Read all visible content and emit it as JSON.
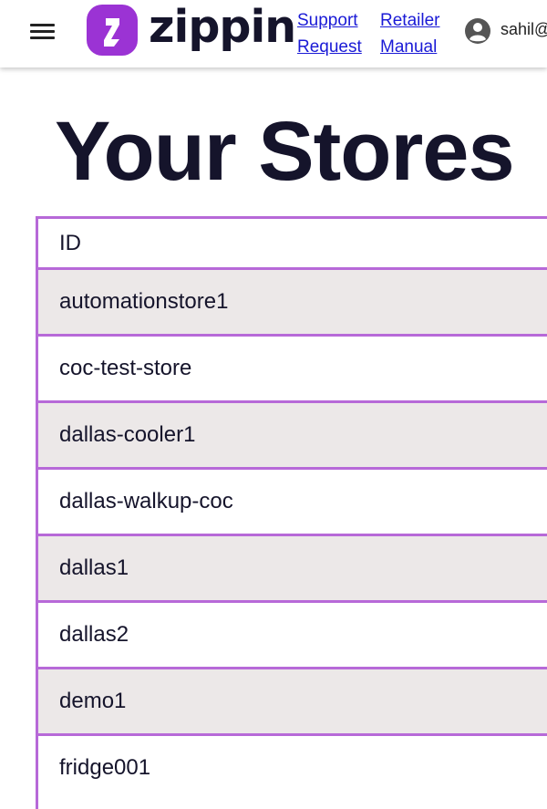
{
  "header": {
    "brand_name": "zippin",
    "nav_links": [
      {
        "lines": [
          "Support",
          "Request"
        ]
      },
      {
        "lines": [
          "Retailer",
          "Manual"
        ]
      }
    ],
    "username": "sahil@",
    "accent_color": "#9b33d4"
  },
  "page": {
    "title": "Your Stores"
  },
  "stores_table": {
    "columns": [
      "ID"
    ],
    "border_color": "#b769d8",
    "shaded_row_color": "#ece8e8",
    "rows": [
      "automationstore1",
      "coc-test-store",
      "dallas-cooler1",
      "dallas-walkup-coc",
      "dallas1",
      "dallas2",
      "demo1",
      "fridge001"
    ]
  },
  "icons": {
    "menu": "hamburger-menu-icon",
    "logo": "zippin-logo-icon",
    "user": "user-account-icon"
  }
}
